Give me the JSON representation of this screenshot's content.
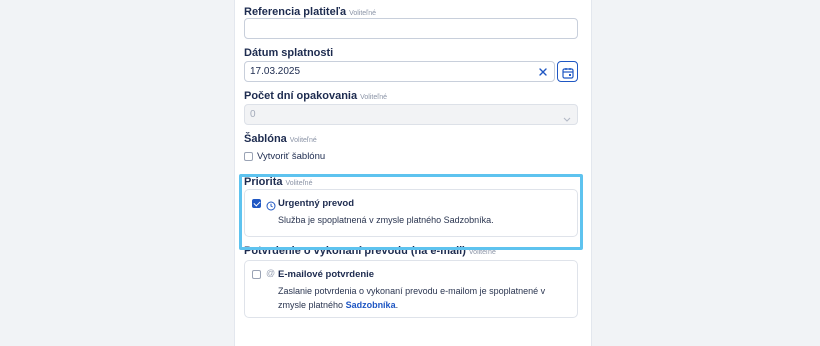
{
  "form": {
    "reference": {
      "label": "Referencia platiteľa",
      "optional": "Voliteľné",
      "value": ""
    },
    "due_date": {
      "label": "Dátum splatnosti",
      "value": "17.03.2025",
      "clear_icon": "close-icon",
      "calendar_icon": "calendar-icon"
    },
    "repeat_days": {
      "label": "Počet dní opakovania",
      "optional": "Voliteľné",
      "value": "0",
      "chevron_icon": "chevron-down-icon"
    },
    "template": {
      "label": "Šablóna",
      "optional": "Voliteľné",
      "checkbox_label": "Vytvoriť šablónu",
      "checked": false
    },
    "priority": {
      "label": "Priorita",
      "optional": "Voliteľné",
      "option_title": "Urgentný prevod",
      "option_desc": "Služba je spoplatnená v zmysle platného Sadzobníka.",
      "checked": true,
      "icon": "clock-icon"
    },
    "confirmation": {
      "label": "Potvrdenie o vykonaní prevodu (na e-mail)",
      "optional": "Voliteľné",
      "option_title": "E-mailové potvrdenie",
      "desc_line1": "Zaslanie potvrdenia o vykonaní prevodu e-mailom je spoplatnené v",
      "desc_line2_prefix": "zmysle platného",
      "desc_link": "Sadzobníka",
      "desc_suffix": ".",
      "checked": false,
      "icon": "at-icon"
    }
  },
  "colors": {
    "accent": "#1f57c3",
    "highlight": "#5ec3ef",
    "text": "#1d2b4f"
  }
}
